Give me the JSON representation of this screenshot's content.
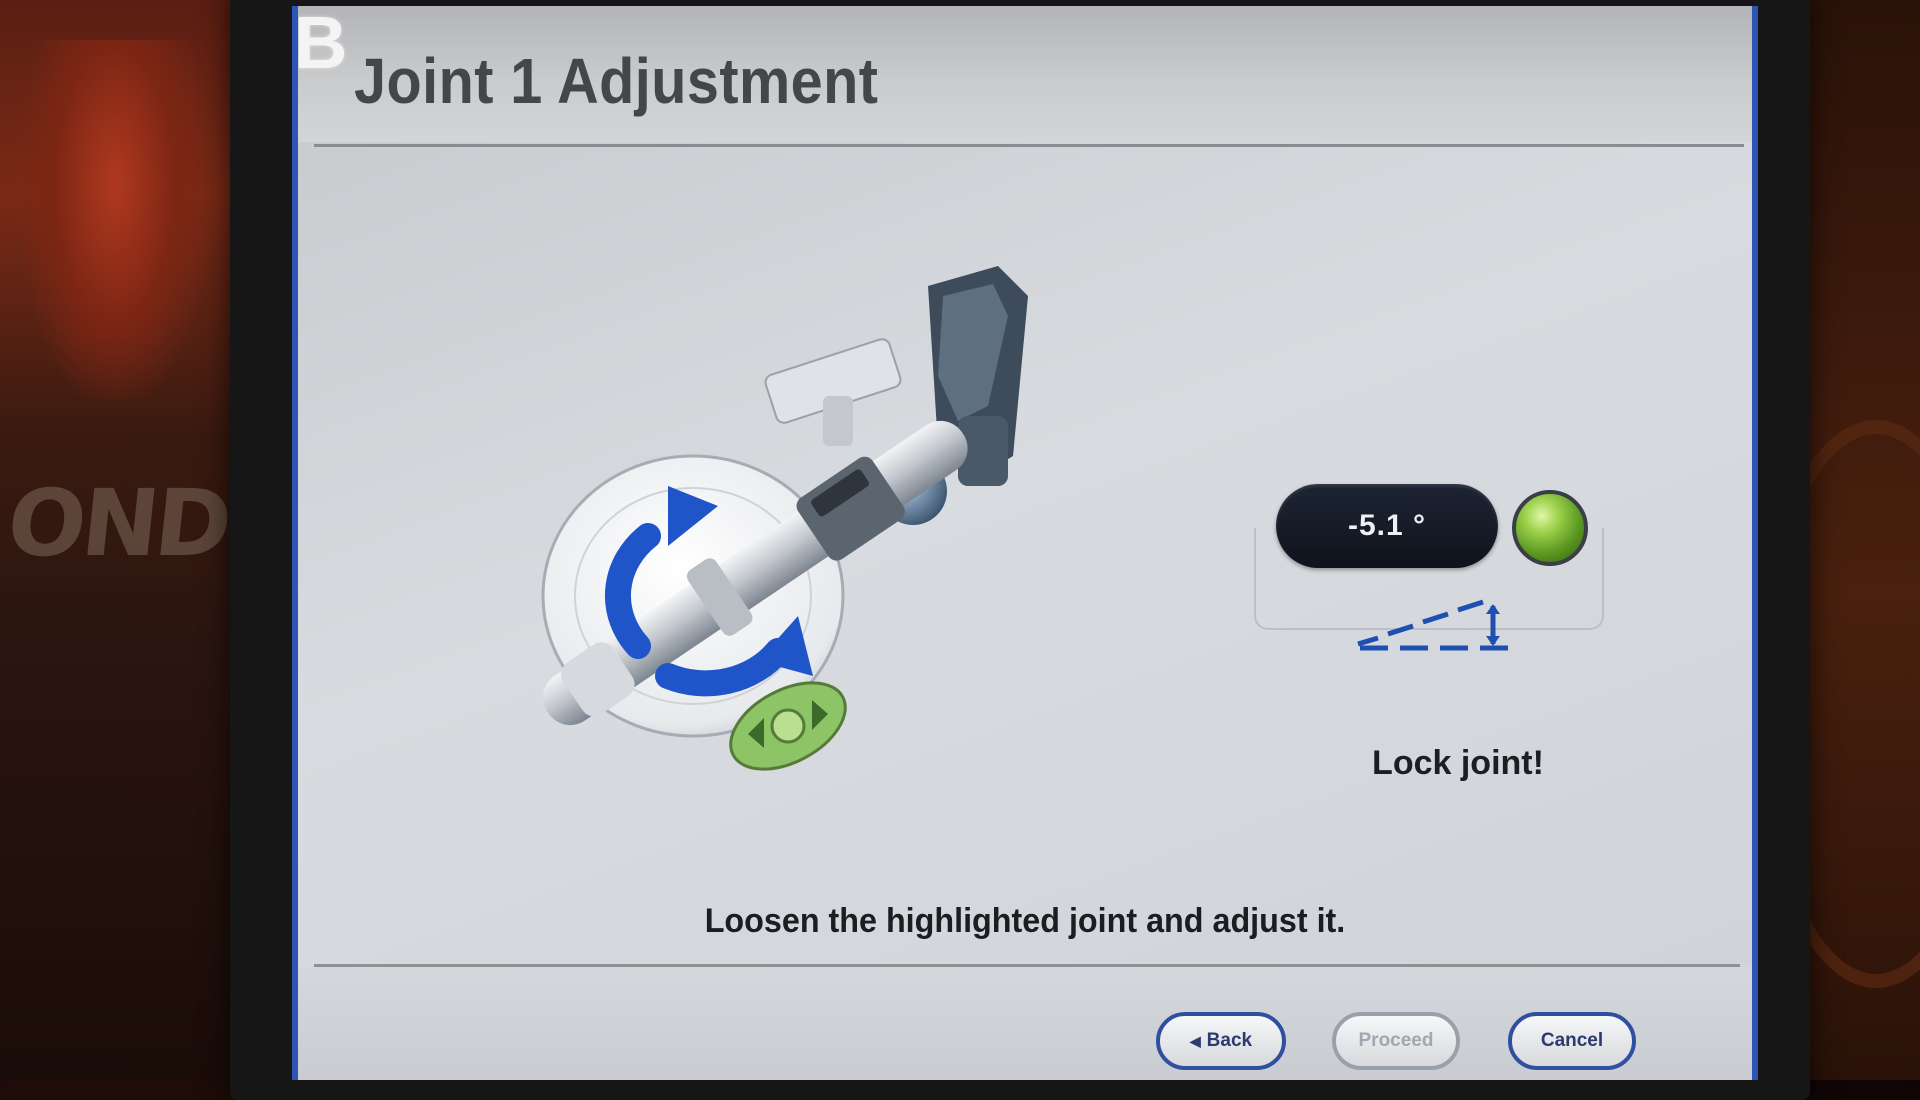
{
  "screen": {
    "badge_letter": "B",
    "title": "Joint 1 Adjustment"
  },
  "status": {
    "angle_value": "-5.1 °",
    "led_state": "green",
    "message": "Lock joint!"
  },
  "instruction": "Loosen the highlighted joint and adjust it.",
  "buttons": {
    "back": "Back",
    "proceed": "Proceed",
    "cancel": "Cancel"
  },
  "background": {
    "partial_logo_text": "ONDP"
  },
  "icons": {
    "back_arrow": "triangle-left",
    "wedge": "angle-wedge-icon",
    "rotation": "rotate-arrow-icon"
  },
  "colors": {
    "accent_blue": "#2e55b6",
    "button_border": "#2f4fa0",
    "led_green": "#7fbf38",
    "pill_dark": "#141a26"
  }
}
